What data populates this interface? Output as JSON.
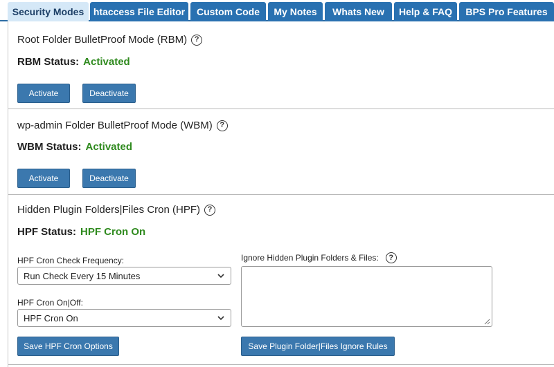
{
  "tabs": [
    {
      "label": "Security Modes",
      "active": true
    },
    {
      "label": "htaccess File Editor",
      "active": false
    },
    {
      "label": "Custom Code",
      "active": false
    },
    {
      "label": "My Notes",
      "active": false
    },
    {
      "label": "Whats New",
      "active": false
    },
    {
      "label": "Help & FAQ",
      "active": false
    },
    {
      "label": "BPS Pro Features",
      "active": false
    }
  ],
  "rbm": {
    "title": "Root Folder BulletProof Mode (RBM)",
    "status_label": "RBM Status:",
    "status_value": "Activated",
    "activate_label": "Activate",
    "deactivate_label": "Deactivate"
  },
  "wbm": {
    "title": "wp-admin Folder BulletProof Mode (WBM)",
    "status_label": "WBM Status:",
    "status_value": "Activated",
    "activate_label": "Activate",
    "deactivate_label": "Deactivate"
  },
  "hpf": {
    "title": "Hidden Plugin Folders|Files Cron (HPF)",
    "status_label": "HPF Status:",
    "status_value": "HPF Cron On",
    "frequency_label": "HPF Cron Check Frequency:",
    "frequency_value": "Run Check Every 15 Minutes",
    "onoff_label": "HPF Cron On|Off:",
    "onoff_value": "HPF Cron On",
    "save_cron_label": "Save HPF Cron Options",
    "ignore_label": "Ignore Hidden Plugin Folders & Files:",
    "ignore_value": "",
    "save_ignore_label": "Save Plugin Folder|Files Ignore Rules"
  },
  "help_glyph": "?",
  "colors": {
    "tab_bg": "#2971b1",
    "tab_active_bg": "#d5e8f7",
    "button_bg": "#3b78ae",
    "status_green": "#2f8a1e"
  }
}
